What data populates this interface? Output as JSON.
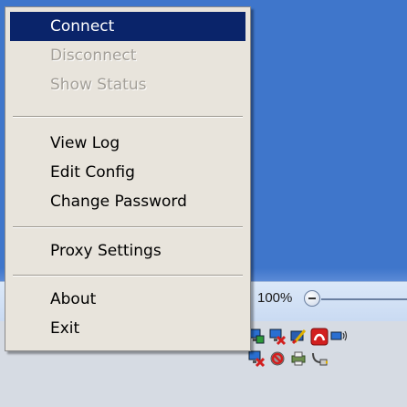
{
  "menu": {
    "items": [
      {
        "label": "Connect",
        "state": "selected"
      },
      {
        "label": "Disconnect",
        "state": "disabled"
      },
      {
        "label": "Show Status",
        "state": "disabled"
      },
      {
        "label": "View Log",
        "state": "enabled"
      },
      {
        "label": "Edit Config",
        "state": "enabled"
      },
      {
        "label": "Change Password",
        "state": "enabled"
      },
      {
        "label": "Proxy Settings",
        "state": "enabled"
      },
      {
        "label": "About",
        "state": "enabled"
      },
      {
        "label": "Exit",
        "state": "enabled"
      }
    ]
  },
  "statusbar": {
    "zoom_label": "100%"
  },
  "tray": {
    "icons": [
      "network-computer-icon",
      "network-disconnected-icon",
      "paint-brush-icon",
      "antivirus-icon",
      "wireless-signal-icon",
      "network-error-icon",
      "blocked-icon",
      "printer-icon",
      "usb-device-icon"
    ]
  },
  "colors": {
    "menu_background": "#e8e4dc",
    "selection_highlight": "#0a246a",
    "disabled_text": "#a39f98",
    "window_blue": "#3f76cb"
  }
}
